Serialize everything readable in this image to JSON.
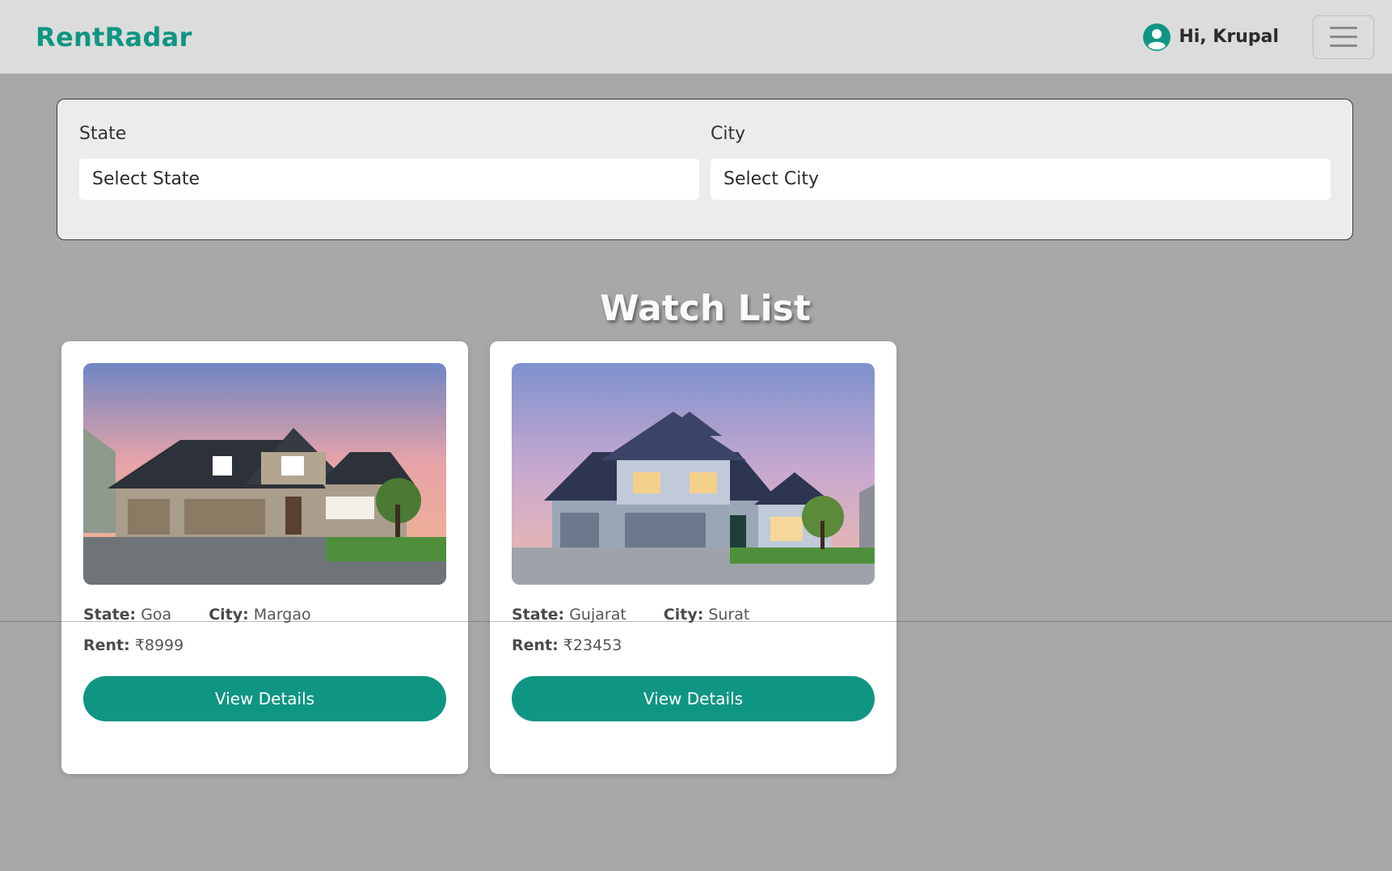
{
  "header": {
    "brand": "RentRadar",
    "greeting": "Hi, Krupal",
    "user_icon": "user-circle-icon",
    "menu_icon": "hamburger-menu-icon"
  },
  "filters": {
    "state_label": "State",
    "state_value": "Select State",
    "city_label": "City",
    "city_value": "Select City"
  },
  "watchlist": {
    "title": "Watch List",
    "cards": [
      {
        "state_key": "State:",
        "state": "Goa",
        "city_key": "City:",
        "city": "Margao",
        "rent_key": "Rent:",
        "rent": "₹8999",
        "button": "View Details"
      },
      {
        "state_key": "State:",
        "state": "Gujarat",
        "city_key": "City:",
        "city": "Surat",
        "rent_key": "Rent:",
        "rent": "₹23453",
        "button": "View Details"
      }
    ]
  },
  "colors": {
    "accent": "#0f9683",
    "page_background": "#a8a8a8",
    "navbar_background": "#dcdcdc"
  }
}
